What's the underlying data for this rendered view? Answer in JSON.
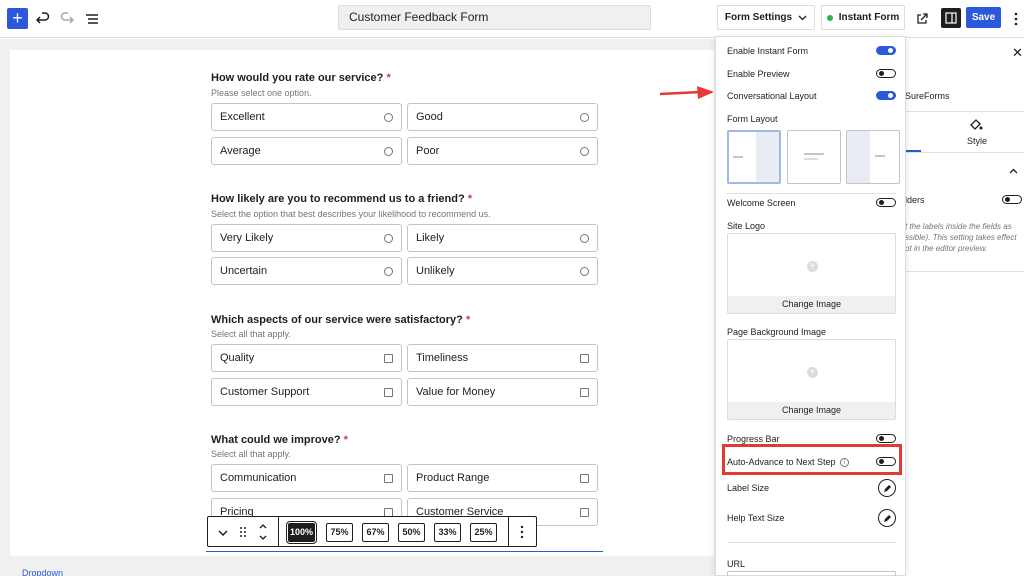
{
  "topbar": {
    "add_label": "+",
    "title": "Customer Feedback Form",
    "form_settings_label": "Form Settings",
    "instant_form_label": "Instant Form",
    "save_label": "Save"
  },
  "questions": [
    {
      "title": "How would you rate our service?",
      "required": "*",
      "subtitle": "Please select one option.",
      "type": "radio",
      "options": [
        "Excellent",
        "Good",
        "Average",
        "Poor"
      ]
    },
    {
      "title": "How likely are you to recommend us to a friend?",
      "required": "*",
      "subtitle": "Select the option that best describes your likelihood to recommend us.",
      "type": "radio",
      "options": [
        "Very Likely",
        "Likely",
        "Uncertain",
        "Unlikely"
      ]
    },
    {
      "title": "Which aspects of our service were satisfactory?",
      "required": "*",
      "subtitle": "Select all that apply.",
      "type": "checkbox",
      "options": [
        "Quality",
        "Timeliness",
        "Customer Support",
        "Value for Money"
      ]
    },
    {
      "title": "What could we improve?",
      "required": "*",
      "subtitle": "Select all that apply.",
      "type": "checkbox",
      "options": [
        "Communication",
        "Product Range",
        "Pricing",
        "Customer Service"
      ]
    }
  ],
  "zoom": {
    "options": [
      "100%",
      "75%",
      "67%",
      "50%",
      "33%",
      "25%"
    ],
    "active": "100%"
  },
  "breadcrumb": "Dropdown",
  "sidebar": {
    "brand": "SureForms",
    "style_tab": "Style",
    "placeholder_label": "lders",
    "help_text": "t the labels inside the fields as ssible). This setting takes effect ot in the editor preview."
  },
  "settings": {
    "enable_instant_form": {
      "label": "Enable Instant Form",
      "on": true
    },
    "enable_preview": {
      "label": "Enable Preview",
      "on": false
    },
    "conversational_layout": {
      "label": "Conversational Layout",
      "on": true
    },
    "form_layout_label": "Form Layout",
    "welcome_screen": {
      "label": "Welcome Screen",
      "on": false
    },
    "site_logo_label": "Site Logo",
    "site_logo_change": "Change Image",
    "page_bg_label": "Page Background Image",
    "page_bg_change": "Change Image",
    "progress_bar": {
      "label": "Progress Bar",
      "on": false
    },
    "auto_advance": {
      "label": "Auto-Advance to Next Step",
      "on": false
    },
    "label_size_label": "Label Size",
    "help_text_size_label": "Help Text Size",
    "url_label": "URL"
  },
  "colors": {
    "accent": "#2b59d9",
    "highlight": "#e53935",
    "toggle_on": "#2b59d9"
  }
}
